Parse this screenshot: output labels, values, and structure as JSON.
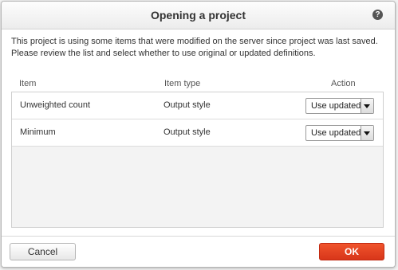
{
  "dialog": {
    "title": "Opening a project",
    "help_icon": "question-icon",
    "message": "This project is using some items that were modified on the server since project was last saved. Please review the list and select whether to use original or updated definitions."
  },
  "table": {
    "columns": [
      "Item",
      "Item type",
      "Action"
    ],
    "rows": [
      {
        "item": "Unweighted count",
        "type": "Output style",
        "action": "Use updated"
      },
      {
        "item": "Minimum",
        "type": "Output style",
        "action": "Use updated"
      }
    ]
  },
  "footer": {
    "cancel_label": "Cancel",
    "ok_label": "OK"
  },
  "colors": {
    "ok_accent": "#e2431f",
    "help_icon": "#555555"
  }
}
